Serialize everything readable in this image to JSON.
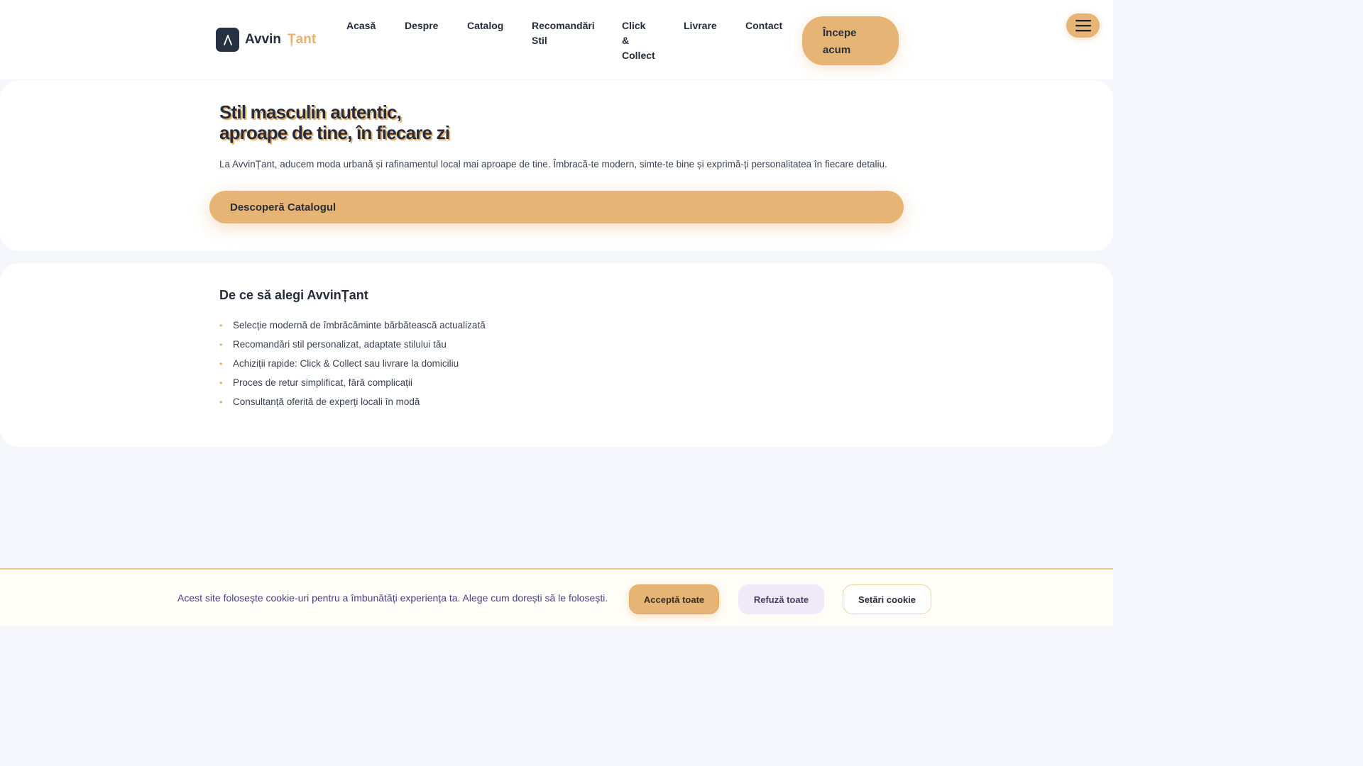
{
  "header": {
    "logo": {
      "word1": "Avvin",
      "word2": "Țant",
      "icon": "a-logo-icon"
    },
    "nav": {
      "home": "Acasă",
      "about": "Despre",
      "catalog": "Catalog",
      "style_line1": "Recomandări",
      "style_line2": "Stil",
      "click_line1": "Click",
      "click_line2": "&",
      "click_line3": "Collect",
      "delivery": "Livrare",
      "contact": "Contact"
    },
    "cta_line1": "Începe",
    "cta_line2": "acum",
    "menu_icon": "hamburger-menu-icon"
  },
  "hero": {
    "title_line1": "Stil masculin autentic,",
    "title_line2": "aproape de tine, în fiecare zi",
    "text": "La AvvinȚant, aducem moda urbană și rafinamentul local mai aproape de tine. Îmbracă-te modern, simte-te bine și exprimă-ți personalitatea în fiecare detaliu.",
    "button": "Descoperă Catalogul"
  },
  "features": {
    "title": "De ce să alegi AvvinȚant",
    "items": [
      "Selecție modernă de îmbrăcăminte bărbătească actualizată",
      "Recomandări stil personalizat, adaptate stilului tău",
      "Achiziții rapide: Click & Collect sau livrare la domiciliu",
      "Proces de retur simplificat, fără complicații",
      "Consultanță oferită de experți locali în modă"
    ],
    "bullet": "•"
  },
  "cookie": {
    "text": "Acest site folosește cookie-uri pentru a îmbunătăți experiența ta. Alege cum dorești să le folosești.",
    "accept": "Acceptă toate",
    "refuse": "Refuză toate",
    "settings": "Setări cookie"
  },
  "colors": {
    "accent": "#e6b474",
    "dark": "#252c3b",
    "page_bg": "#f4f6fb",
    "cookie_text": "#4a3d86"
  }
}
